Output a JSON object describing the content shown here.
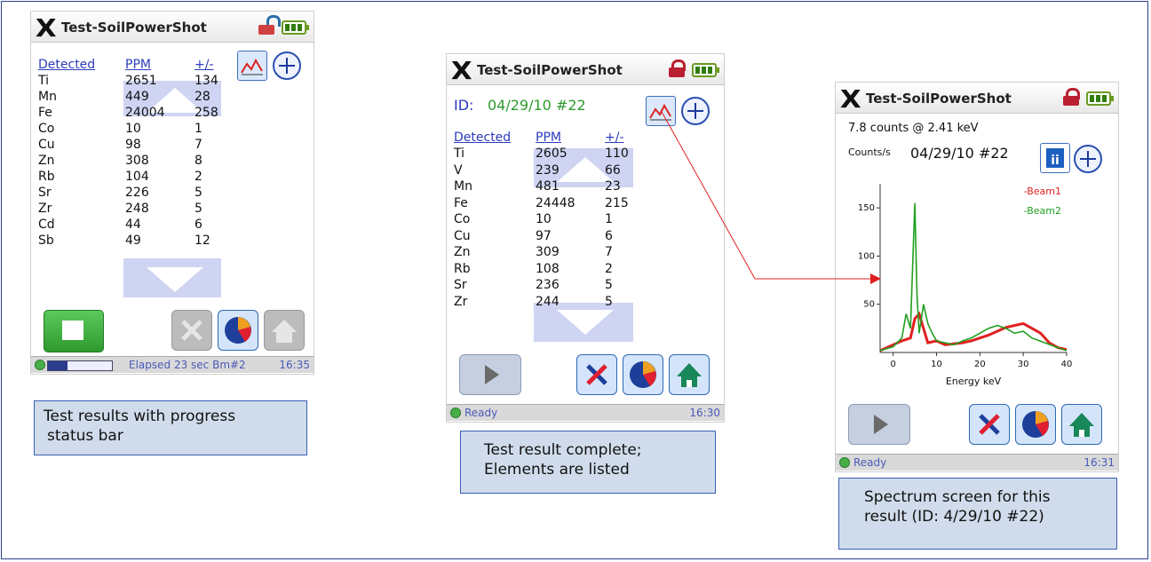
{
  "app": {
    "title": "Test-SoilPowerShot"
  },
  "screen1": {
    "headers": [
      "Detected",
      "PPM",
      "+/-"
    ],
    "rows": [
      [
        "Ti",
        "2651",
        "134"
      ],
      [
        "Mn",
        "449",
        "28"
      ],
      [
        "Fe",
        "24004",
        "258"
      ],
      [
        "Co",
        "10",
        "1"
      ],
      [
        "Cu",
        "98",
        "7"
      ],
      [
        "Zn",
        "308",
        "8"
      ],
      [
        "Rb",
        "104",
        "2"
      ],
      [
        "Sr",
        "226",
        "5"
      ],
      [
        "Zr",
        "248",
        "5"
      ],
      [
        "Cd",
        "44",
        "6"
      ],
      [
        "Sb",
        "49",
        "12"
      ]
    ],
    "status_text": "Elapsed 23 sec Bm#2",
    "time": "16:35"
  },
  "screen2": {
    "id_label": "ID:",
    "id_value": "04/29/10 #22",
    "headers": [
      "Detected",
      "PPM",
      "+/-"
    ],
    "rows": [
      [
        "Ti",
        "2605",
        "110"
      ],
      [
        "V",
        "239",
        "66"
      ],
      [
        "Mn",
        "481",
        "23"
      ],
      [
        "Fe",
        "24448",
        "215"
      ],
      [
        "Co",
        "10",
        "1"
      ],
      [
        "Cu",
        "97",
        "6"
      ],
      [
        "Zn",
        "309",
        "7"
      ],
      [
        "Rb",
        "108",
        "2"
      ],
      [
        "Sr",
        "236",
        "5"
      ],
      [
        "Zr",
        "244",
        "5"
      ]
    ],
    "status_text": "Ready",
    "time": "16:30"
  },
  "screen3": {
    "readout": "7.8 counts @ 2.41 keV",
    "ylabel": "Counts/s",
    "id_value": "04/29/10 #22",
    "status_text": "Ready",
    "time": "16:31"
  },
  "chart_data": {
    "type": "line",
    "xlabel": "Energy keV",
    "ylabel": "Counts/s",
    "xlim": [
      -3,
      40
    ],
    "ylim": [
      0,
      175
    ],
    "xticks": [
      "0",
      "10",
      "20",
      "30",
      "40"
    ],
    "yticks": [
      "50",
      "100",
      "150"
    ],
    "legend_position": "top-right",
    "series": [
      {
        "name": "Beam1",
        "color": "#e02020",
        "x": [
          -3,
          0,
          2,
          4,
          5,
          6,
          8,
          10,
          12,
          14,
          16,
          18,
          20,
          22,
          24,
          26,
          28,
          30,
          32,
          34,
          36,
          38,
          40
        ],
        "y": [
          2,
          8,
          12,
          15,
          35,
          40,
          10,
          12,
          8,
          9,
          10,
          12,
          15,
          18,
          22,
          26,
          28,
          30,
          25,
          20,
          10,
          5,
          3
        ]
      },
      {
        "name": "Beam2",
        "color": "#20a020",
        "x": [
          -3,
          0,
          2,
          3,
          4,
          5,
          5.5,
          6,
          7,
          8,
          9,
          10,
          12,
          14,
          16,
          18,
          20,
          22,
          24,
          26,
          28,
          30,
          32,
          35,
          38,
          40
        ],
        "y": [
          2,
          6,
          15,
          40,
          25,
          155,
          60,
          20,
          50,
          30,
          20,
          12,
          10,
          8,
          12,
          15,
          20,
          25,
          28,
          25,
          20,
          22,
          15,
          10,
          5,
          2
        ]
      }
    ]
  },
  "captions": {
    "c1": [
      "Test results with progress",
      "status bar"
    ],
    "c2": [
      "Test result complete;",
      "Elements are listed"
    ],
    "c3": [
      "Spectrum screen for this",
      "result (ID: 4/29/10 #22)"
    ]
  }
}
